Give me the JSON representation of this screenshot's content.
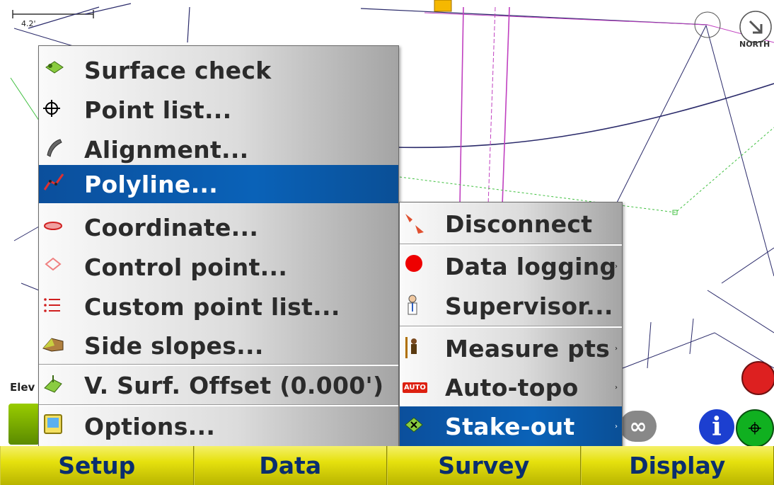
{
  "map": {
    "scale_label": "4.2'",
    "elevation_label": "Elev",
    "north_label": "NORTH"
  },
  "main_menu": {
    "items": [
      {
        "label": "Surface check",
        "icon": "surface-check-icon"
      },
      {
        "label": "Point list...",
        "icon": "crosshair-icon"
      },
      {
        "label": "Alignment...",
        "icon": "alignment-icon"
      },
      {
        "label": "Polyline...",
        "icon": "polyline-icon",
        "selected": true
      },
      {
        "label": "Coordinate...",
        "icon": "coordinate-icon"
      },
      {
        "label": "Control point...",
        "icon": "control-point-icon"
      },
      {
        "label": "Custom point list...",
        "icon": "custom-list-icon"
      },
      {
        "label": "Side slopes...",
        "icon": "side-slopes-icon"
      },
      {
        "label": "V. Surf. Offset (0.000')",
        "icon": "surface-offset-icon"
      },
      {
        "label": "Options...",
        "icon": "options-icon"
      }
    ]
  },
  "sub_menu": {
    "items": [
      {
        "label": "Disconnect",
        "icon": "disconnect-icon"
      },
      {
        "label": "Data logging",
        "icon": "red-dot-icon",
        "submenu_arrow": "›"
      },
      {
        "label": "Supervisor...",
        "icon": "supervisor-icon"
      },
      {
        "label": "Measure pts",
        "icon": "measure-points-icon",
        "submenu_arrow": "›"
      },
      {
        "label": "Auto-topo",
        "icon": "auto-topo-icon",
        "submenu_arrow": "›",
        "icon_text": "AUTO"
      },
      {
        "label": "Stake-out",
        "icon": "stake-out-icon",
        "submenu_arrow": "›",
        "selected": true
      }
    ]
  },
  "bottom_bar": {
    "tabs": [
      "Setup",
      "Data",
      "Survey",
      "Display"
    ]
  },
  "colors": {
    "menu_selected": "#0a5fb4",
    "bottom_bar": "#e6e10e",
    "tab_text": "#0a2e6e",
    "map_line_purple": "#c040c0",
    "map_line_navy": "#2a2a6a",
    "map_line_green": "#40c040"
  }
}
